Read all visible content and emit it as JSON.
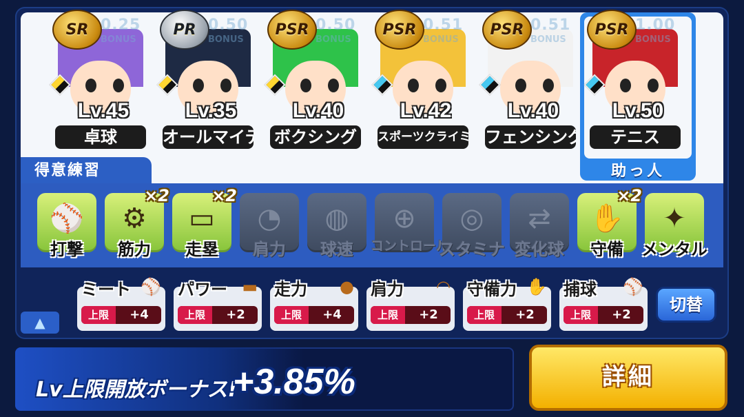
{
  "deck": [
    {
      "rarity": "SR",
      "bonus_rate": "0.25",
      "bonus_word": "BONUS",
      "level": "Lv.45",
      "sport": "卓球",
      "hair": "#8e66d8"
    },
    {
      "rarity": "PR",
      "bonus_rate": "0.50",
      "bonus_word": "BONUS",
      "level": "Lv.35",
      "sport": "オールマイティ",
      "hair": "#1e2a44"
    },
    {
      "rarity": "PSR",
      "bonus_rate": "0.50",
      "bonus_word": "BONUS",
      "level": "Lv.40",
      "sport": "ボクシング",
      "hair": "#2ec24a"
    },
    {
      "rarity": "PSR",
      "bonus_rate": "0.51",
      "bonus_word": "BONUS",
      "level": "Lv.42",
      "sport": "スポーツクライミング",
      "hair": "#f3c23a"
    },
    {
      "rarity": "PSR",
      "bonus_rate": "0.51",
      "bonus_word": "BONUS",
      "level": "Lv.40",
      "sport": "フェンシング",
      "hair": "#f2f2f2"
    },
    {
      "rarity": "PSR",
      "bonus_rate": "1.00",
      "bonus_word": "BONUS",
      "level": "Lv.50",
      "sport": "テニス",
      "hair": "#c8242a"
    }
  ],
  "helper_label": "助っ人",
  "practice_header": "得意練習",
  "practice": [
    {
      "name": "打撃",
      "mult": "",
      "active": true
    },
    {
      "name": "筋力",
      "mult": "×2",
      "active": true
    },
    {
      "name": "走塁",
      "mult": "×2",
      "active": true
    },
    {
      "name": "肩力",
      "mult": "",
      "active": false
    },
    {
      "name": "球速",
      "mult": "",
      "active": false
    },
    {
      "name": "コントロール",
      "mult": "",
      "active": false
    },
    {
      "name": "スタミナ",
      "mult": "",
      "active": false
    },
    {
      "name": "変化球",
      "mult": "",
      "active": false
    },
    {
      "name": "守備",
      "mult": "×2",
      "active": true
    },
    {
      "name": "メンタル",
      "mult": "",
      "active": true
    }
  ],
  "limits": [
    {
      "stat": "ミート",
      "tag": "上限",
      "value": "+4"
    },
    {
      "stat": "パワー",
      "tag": "上限",
      "value": "+2"
    },
    {
      "stat": "走力",
      "tag": "上限",
      "value": "+4"
    },
    {
      "stat": "肩力",
      "tag": "上限",
      "value": "+2"
    },
    {
      "stat": "守備力",
      "tag": "上限",
      "value": "+2"
    },
    {
      "stat": "捕球",
      "tag": "上限",
      "value": "+2"
    }
  ],
  "switch_label": "切替",
  "collapse_icon": "▲",
  "bonus_title": "Lv上限開放ボーナス!",
  "bonus_value": "+3.85%",
  "detail_label": "詳細"
}
